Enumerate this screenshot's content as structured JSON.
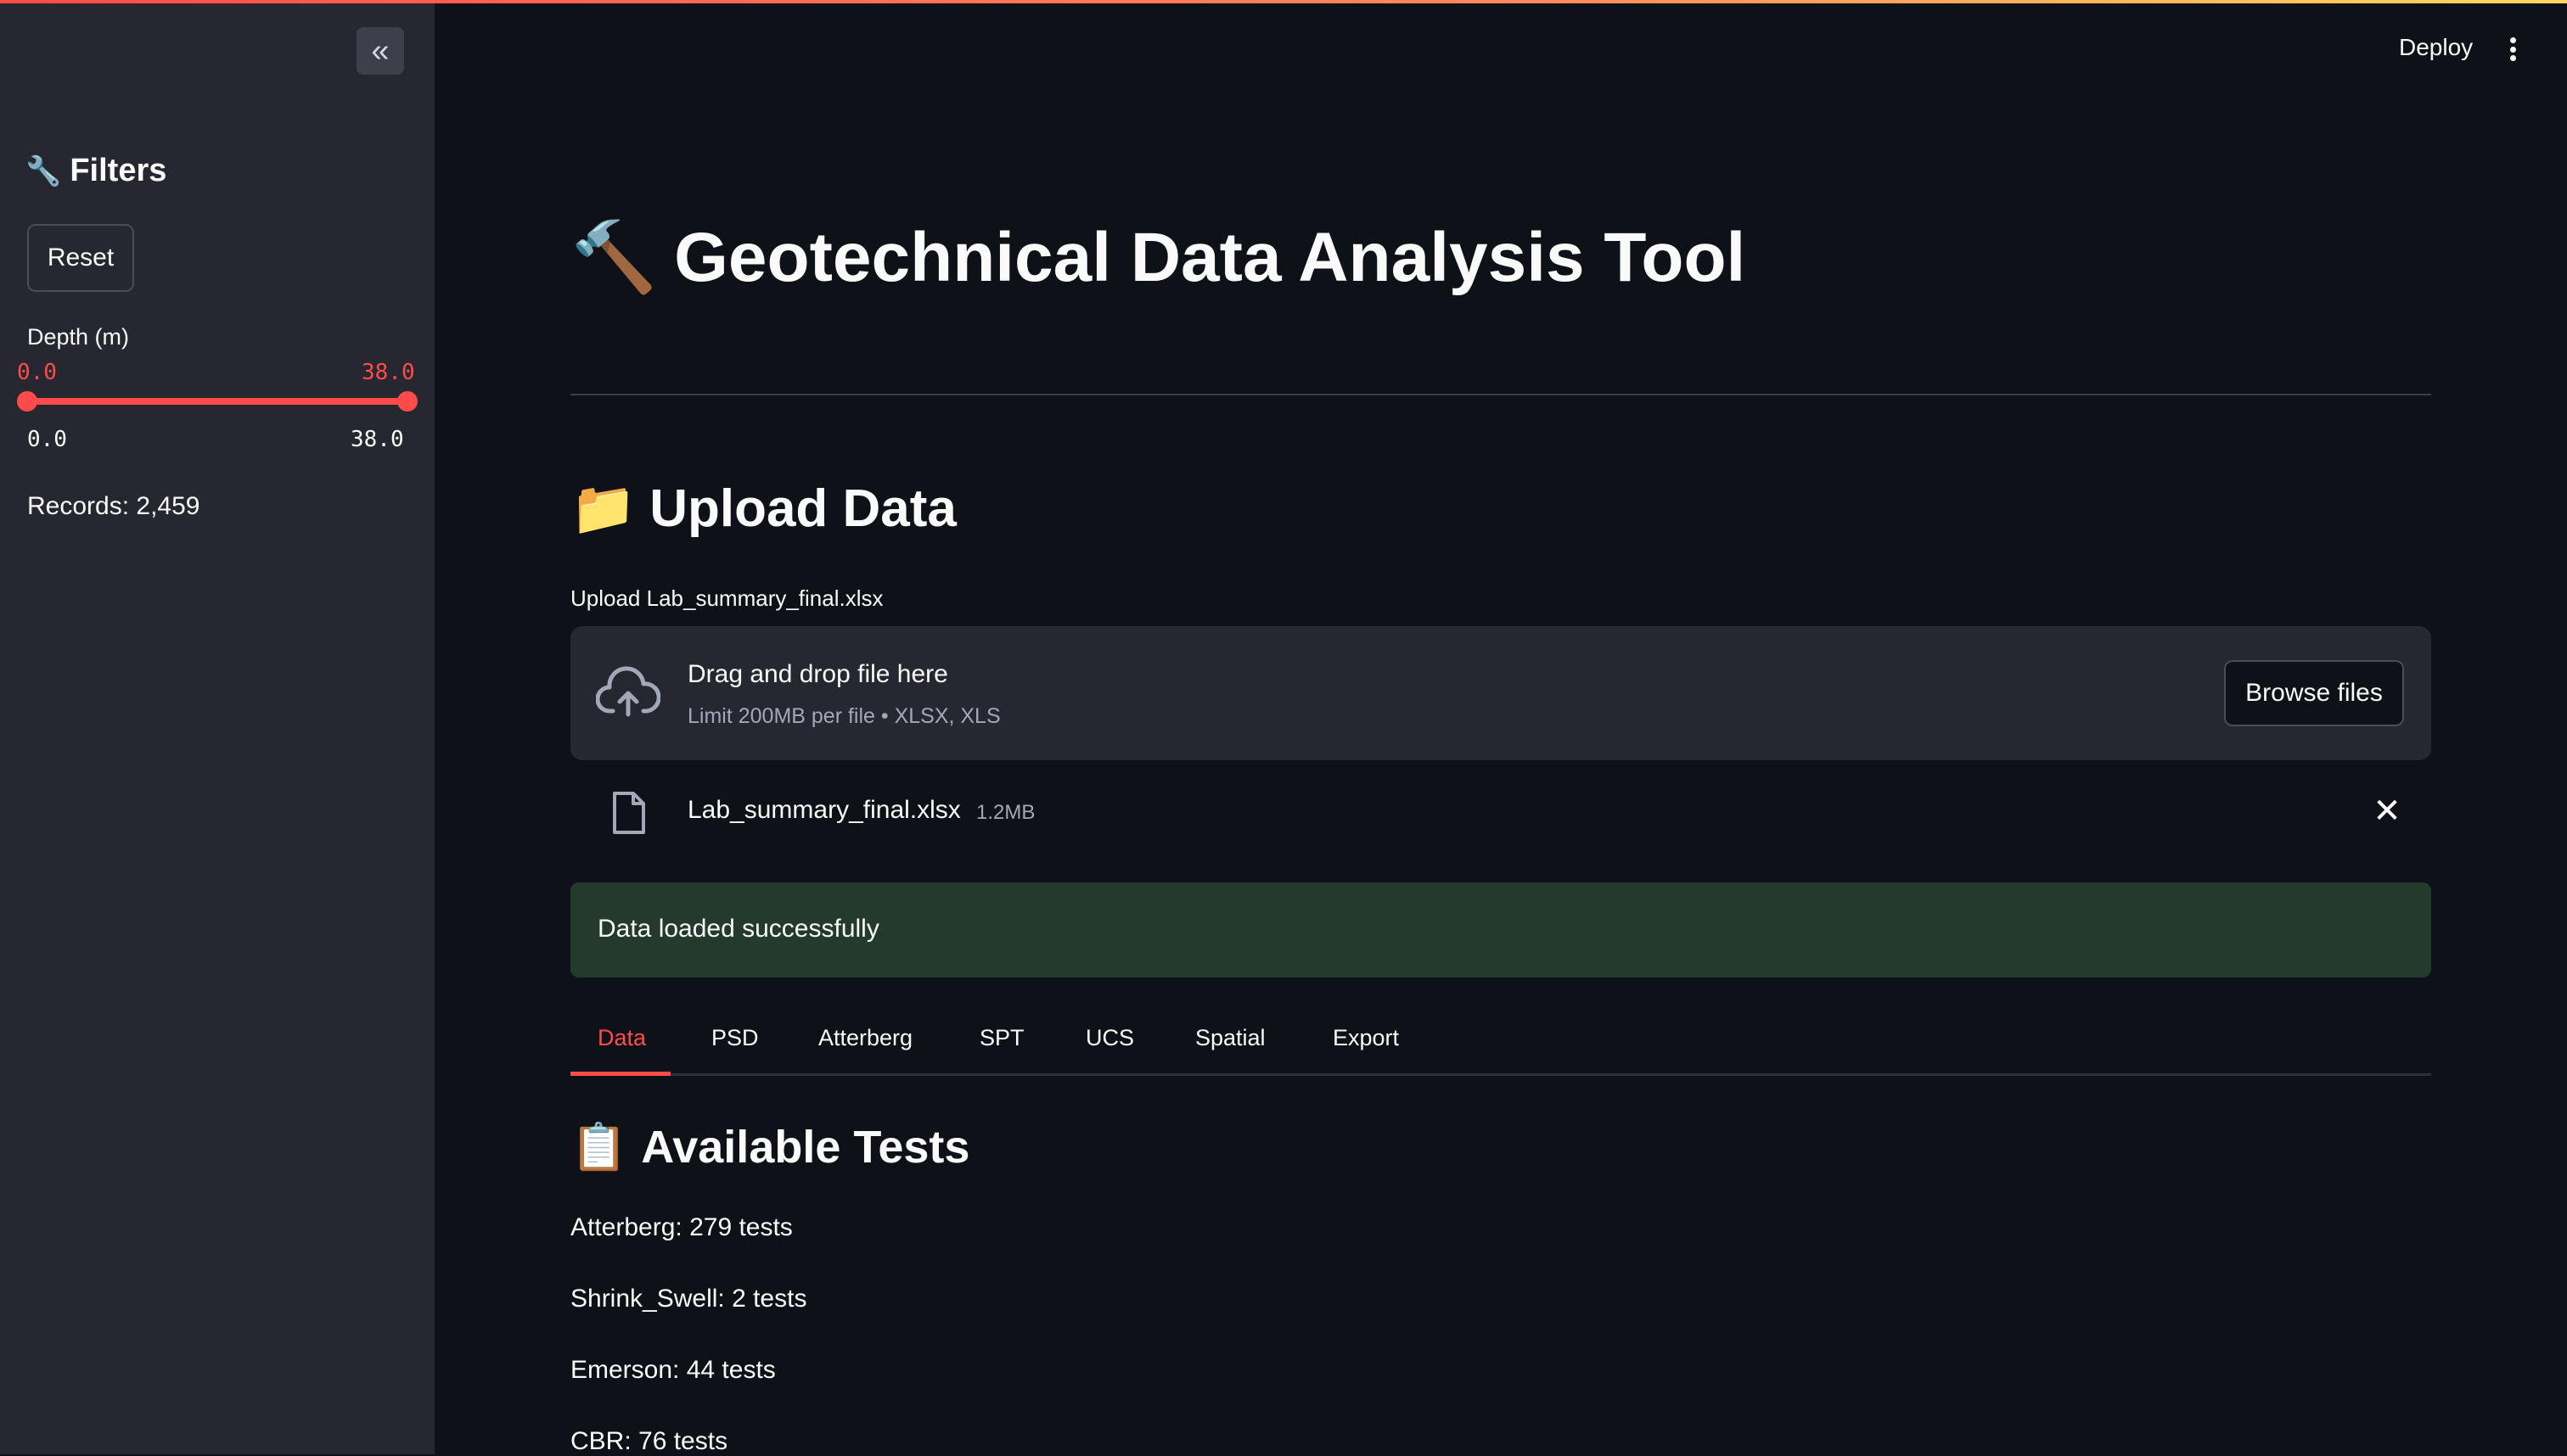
{
  "sidebar": {
    "collapse_icon": "«",
    "filters_icon": "🔧",
    "filters_title": "Filters",
    "reset_label": "Reset",
    "depth_label": "Depth (m)",
    "depth_low": "0.0",
    "depth_high": "38.0",
    "depth_min": "0.0",
    "depth_max": "38.0",
    "records": "Records: 2,459"
  },
  "header": {
    "deploy_label": "Deploy",
    "menu_icon": "kebab-menu-icon"
  },
  "main": {
    "title_icon": "🔨",
    "title": "Geotechnical Data Analysis Tool",
    "upload_icon": "📁",
    "upload_heading": "Upload Data",
    "upload_label": "Upload Lab_summary_final.xlsx",
    "dropzone_title": "Drag and drop file here",
    "dropzone_limit": "Limit 200MB per file • XLSX, XLS",
    "browse_label": "Browse files",
    "file_name": "Lab_summary_final.xlsx",
    "file_size": "1.2MB",
    "success_message": "Data loaded successfully",
    "tabs": [
      "Data",
      "PSD",
      "Atterberg",
      "SPT",
      "UCS",
      "Spatial",
      "Export"
    ],
    "active_tab": "Data",
    "tests_icon": "📋",
    "tests_heading": "Available Tests",
    "tests": [
      "Atterberg: 279 tests",
      "Shrink_Swell: 2 tests",
      "Emerson: 44 tests",
      "CBR: 76 tests"
    ]
  },
  "colors": {
    "accent": "#ff4b4b",
    "sidebar_bg": "#262730",
    "app_bg": "#0e1117",
    "success_bg": "#233a2c"
  }
}
